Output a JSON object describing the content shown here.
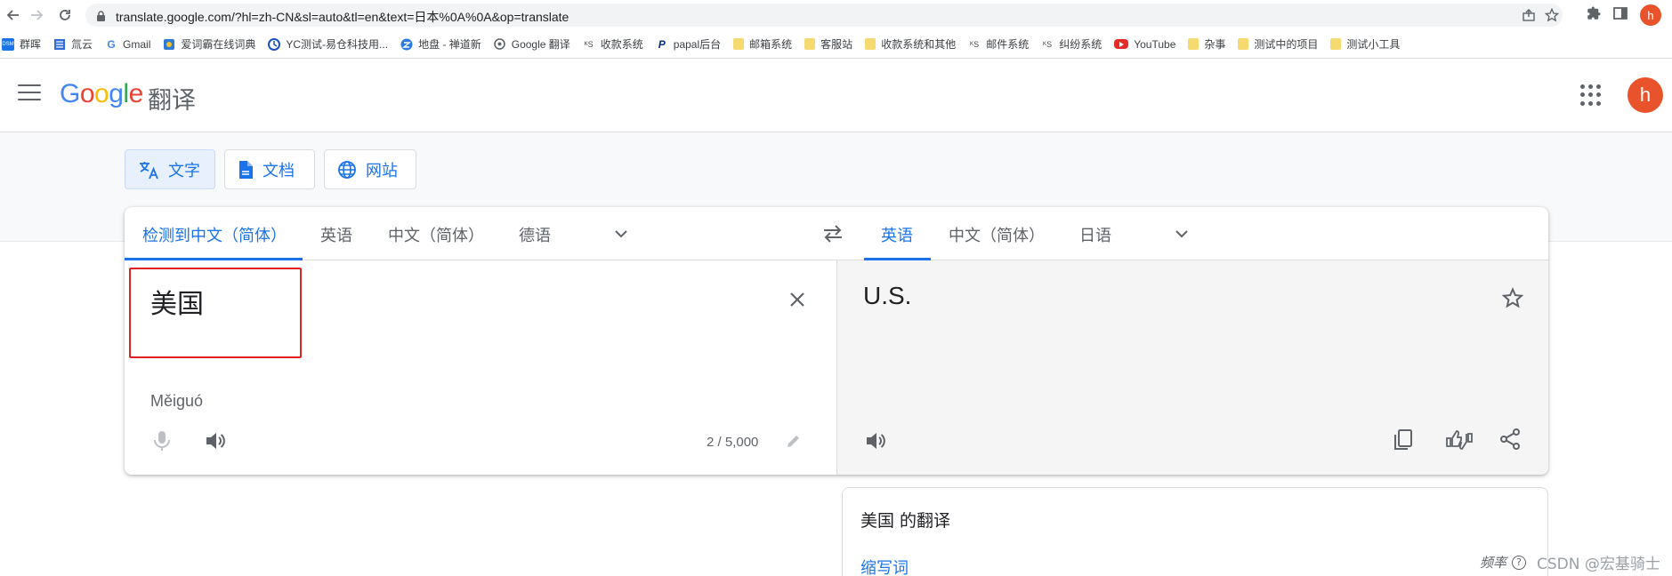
{
  "browser": {
    "url": "translate.google.com/?hl=zh-CN&sl=auto&tl=en&text=日本%0A%0A&op=translate",
    "profile_initial": "h"
  },
  "bookmarks": [
    {
      "label": "群晖",
      "icon": "dsm-icon",
      "kind": "dsm"
    },
    {
      "label": "氚云",
      "icon": "h3-icon",
      "kind": "h3"
    },
    {
      "label": "Gmail",
      "icon": "google-icon",
      "kind": "g"
    },
    {
      "label": "爱词霸在线词典",
      "icon": "iciba-icon",
      "kind": "ic"
    },
    {
      "label": "YC测试-易仓科技用...",
      "icon": "yc-icon",
      "kind": "yc"
    },
    {
      "label": "地盘 - 禅道新",
      "icon": "zentao-icon",
      "kind": "zt"
    },
    {
      "label": "Google 翻译",
      "icon": "translate-icon",
      "kind": "gt"
    },
    {
      "label": "收款系统",
      "icon": "ks-icon",
      "kind": "ks"
    },
    {
      "label": "papal后台",
      "icon": "paypal-icon",
      "kind": "pp"
    },
    {
      "label": "邮箱系统",
      "icon": "folder-icon",
      "kind": "folder"
    },
    {
      "label": "客服站",
      "icon": "folder-icon",
      "kind": "folder"
    },
    {
      "label": "收款系统和其他",
      "icon": "folder-icon",
      "kind": "folder"
    },
    {
      "label": "邮件系统",
      "icon": "ks-icon",
      "kind": "ks"
    },
    {
      "label": "纠纷系统",
      "icon": "ks-icon",
      "kind": "ks"
    },
    {
      "label": "YouTube",
      "icon": "youtube-icon",
      "kind": "yt"
    },
    {
      "label": "杂事",
      "icon": "folder-icon",
      "kind": "folder"
    },
    {
      "label": "测试中的项目",
      "icon": "folder-icon",
      "kind": "folder"
    },
    {
      "label": "测试小工具",
      "icon": "folder-icon",
      "kind": "folder"
    }
  ],
  "header": {
    "logo": "Google",
    "product": "翻译",
    "profile_initial": "h"
  },
  "modes": {
    "text": "文字",
    "docs": "文档",
    "websites": "网站"
  },
  "source_langs": {
    "detected": "检测到中文（简体）",
    "l1": "英语",
    "l2": "中文（简体）",
    "l3": "德语"
  },
  "target_langs": {
    "l1": "英语",
    "l2": "中文（简体）",
    "l3": "日语"
  },
  "source": {
    "text": "美国",
    "romanization": "Měiguó",
    "char_count": "2 / 5,000"
  },
  "target": {
    "text": "U.S."
  },
  "dictionary": {
    "title": "美国 的翻译",
    "pos": "缩写词",
    "frequency_label": "频率",
    "help": "?"
  },
  "watermark": "CSDN @宏基骑士",
  "colors": {
    "accent": "#1a73e8",
    "highlight_box": "#e0201e",
    "profile": "#e8532c"
  }
}
